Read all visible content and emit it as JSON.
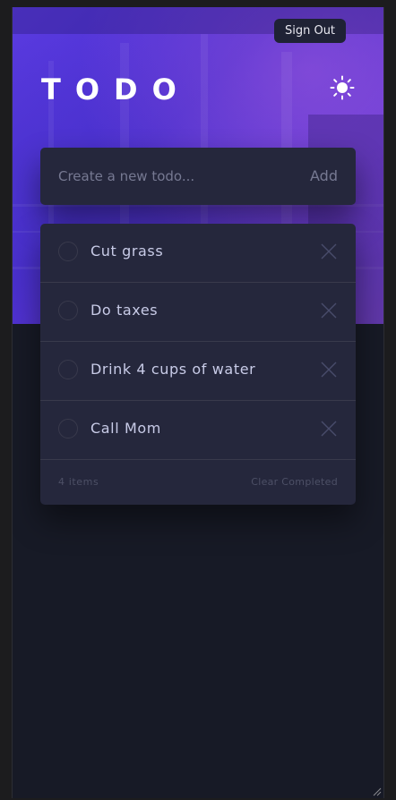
{
  "header": {
    "sign_out_label": "Sign Out",
    "title": "TODO",
    "theme_icon": "sun-icon"
  },
  "new_todo": {
    "placeholder": "Create a new todo...",
    "value": "",
    "add_label": "Add"
  },
  "todos": [
    {
      "text": "Cut grass",
      "completed": false
    },
    {
      "text": "Do taxes",
      "completed": false
    },
    {
      "text": "Drink 4 cups of water",
      "completed": false
    },
    {
      "text": "Call Mom",
      "completed": false
    }
  ],
  "footer": {
    "items_left": "4 items",
    "clear_completed_label": "Clear Completed"
  },
  "colors": {
    "card_background": "#25273c",
    "page_background": "#171a26",
    "hero_gradient_start": "#5a3be0",
    "hero_gradient_end": "#7a47c7",
    "todo_text": "#c8cbe7",
    "muted_text": "#4d5066"
  }
}
